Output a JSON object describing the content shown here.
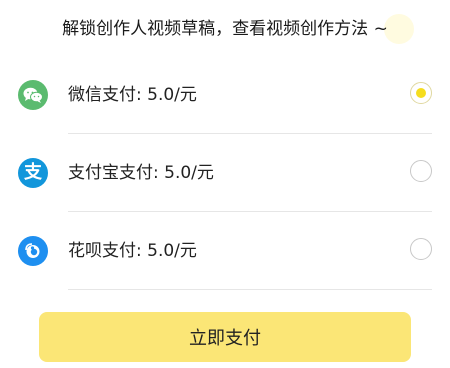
{
  "header": {
    "title": "解锁创作人视频草稿，查看视频创作方法 ~"
  },
  "payment_methods": [
    {
      "label": "微信支付: 5.0/元",
      "icon": "wechat-pay-icon",
      "icon_color": "#5bbb6f",
      "selected": true
    },
    {
      "label": "支付宝支付: 5.0/元",
      "icon": "alipay-icon",
      "icon_color": "#1296db",
      "selected": false
    },
    {
      "label": "花呗支付: 5.0/元",
      "icon": "huabei-icon",
      "icon_color": "#1e8ff0",
      "selected": false
    }
  ],
  "pay_button": {
    "label": "立即支付",
    "color": "#fbe676"
  },
  "colors": {
    "radio_selected": "#f5dd1e"
  }
}
